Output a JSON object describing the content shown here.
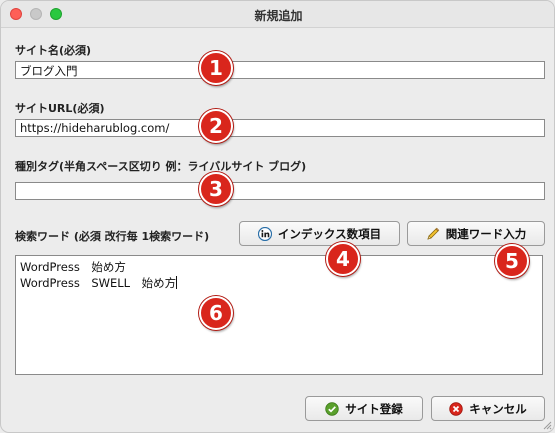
{
  "window": {
    "title": "新規追加"
  },
  "site_name": {
    "label": "サイト名(必須)",
    "value": "ブログ入門"
  },
  "site_url": {
    "label": "サイトURL(必須)",
    "value": "https://hideharublog.com/"
  },
  "type_tags": {
    "label": "種別タグ(半角スペース区切り 例：ライバルサイト ブログ)",
    "value": ""
  },
  "keywords": {
    "label": "検索ワード (必須 改行毎 1検索ワード)",
    "lines": [
      "WordPress　始め方",
      "WordPress　SWELL　始め方"
    ]
  },
  "buttons": {
    "index_items": "インデックス数項目",
    "related_words": "関連ワード入力",
    "register": "サイト登録",
    "cancel": "キャンセル"
  },
  "annotations": [
    "1",
    "2",
    "3",
    "4",
    "5",
    "6"
  ],
  "icons": {
    "index_items": "linkedin-in-icon",
    "related_words": "pencil-icon",
    "register": "check-circle-icon",
    "cancel": "x-circle-icon"
  },
  "colors": {
    "annotation_badge": "#d9261c",
    "register_icon": "#5aa02c",
    "cancel_icon": "#d8261c"
  }
}
